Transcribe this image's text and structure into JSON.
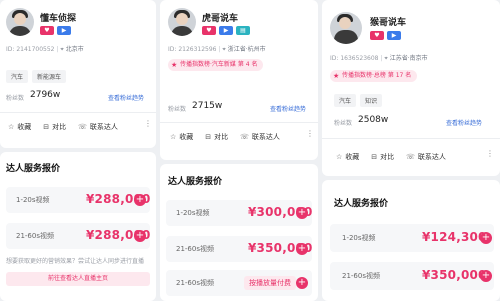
{
  "cards": [
    {
      "name": "懂车侦探",
      "id_text": "ID: 2141700552",
      "location": "北京市",
      "rank_text": "",
      "tags": [
        "汽车",
        "新能源车"
      ],
      "fans_label": "粉丝数",
      "fans_value": "2796w",
      "fans_link": "查看粉丝趋势",
      "actions": {
        "collect": "收藏",
        "compare": "对比",
        "contact": "联系达人"
      },
      "pricing_title": "达人服务报价",
      "prices": [
        {
          "label": "1-20s视频",
          "value": "¥288,000"
        },
        {
          "label": "21-60s视频",
          "value": "¥288,000"
        }
      ],
      "hint": "想要获取更好的营销效果？尝试让达人同步进行直播",
      "cta": "前往查看达人直播主页"
    },
    {
      "name": "虎哥说车",
      "id_text": "ID: 2126312596",
      "location": "浙江省·杭州市",
      "rank_text": "传播指数榜·汽车新媒 第 4 名",
      "tags": [],
      "fans_label": "粉丝数",
      "fans_value": "2715w",
      "fans_link": "查看粉丝趋势",
      "actions": {
        "collect": "收藏",
        "compare": "对比",
        "contact": "联系达人"
      },
      "pricing_title": "达人服务报价",
      "prices": [
        {
          "label": "1-20s视频",
          "value": "¥300,000"
        },
        {
          "label": "21-60s视频",
          "value": "¥350,000"
        },
        {
          "label": "21-60s视频",
          "value": ""
        }
      ],
      "book_label": "按播放量付费"
    },
    {
      "name": "猴哥说车",
      "id_text": "ID: 1636523608",
      "location": "江苏省·南京市",
      "rank_text": "传播指数榜·总榜 第 17 名",
      "tags": [
        "汽车",
        "知识"
      ],
      "fans_label": "粉丝数",
      "fans_value": "2508w",
      "fans_link": "查看粉丝趋势",
      "actions": {
        "collect": "收藏",
        "compare": "对比",
        "contact": "联系达人"
      },
      "pricing_title": "达人服务报价",
      "prices": [
        {
          "label": "1-20s视频",
          "value": "¥124,300"
        },
        {
          "label": "21-60s视频",
          "value": "¥350,000"
        }
      ]
    }
  ],
  "icons": {
    "star": "star-icon",
    "compare": "compare-icon",
    "contact": "contact-icon",
    "plus": "plus-icon",
    "more": "more-icon"
  },
  "colors": {
    "accent": "#e8336a",
    "link": "#3b6fd8",
    "rank_bg": "#fde8ee"
  }
}
